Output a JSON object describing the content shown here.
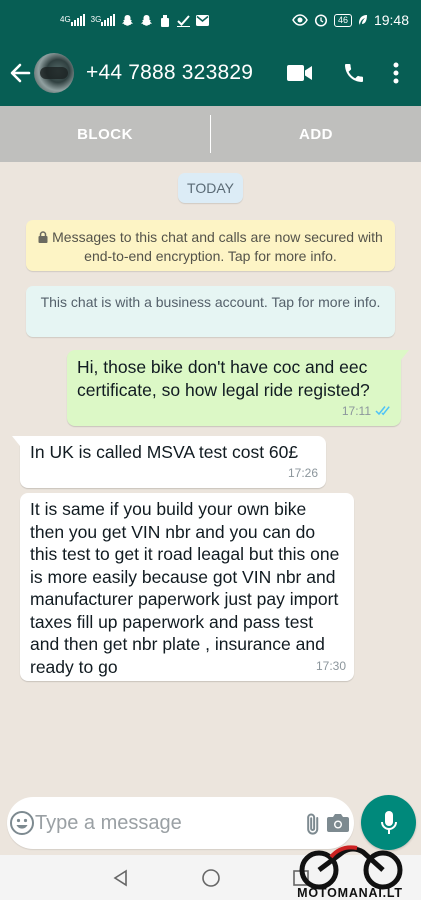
{
  "status_bar": {
    "left_icons": [
      "4G-signal-icon",
      "3G-signal-icon",
      "snapchat-icon",
      "snapchat-icon",
      "clean-icon",
      "check-icon",
      "gmail-icon"
    ],
    "network_label_1": "4G",
    "network_label_2": "3G",
    "battery": "46",
    "time": "19:48"
  },
  "header": {
    "contact_name": "+44 7888 323829"
  },
  "action_bar": {
    "block_label": "BLOCK",
    "add_label": "ADD"
  },
  "chat": {
    "date_pill": "TODAY",
    "encryption_notice": "Messages to this chat and calls are now secured with end-to-end encryption. Tap for more info.",
    "business_notice": "This chat is with a business account. Tap for more info.",
    "messages": [
      {
        "direction": "outgoing",
        "text": "Hi, those bike don't have coc and eec certificate, so how legal ride registed?",
        "time": "17:11",
        "status": "read"
      },
      {
        "direction": "incoming",
        "text": "In UK is called MSVA test cost 60£",
        "time": "17:26"
      },
      {
        "direction": "incoming",
        "text": "It is same if you build your own bike then you get VIN nbr and you can do this test to get it road leagal but this one is more easily because got VIN nbr and manufacturer paperwork just pay import taxes fill up paperwork and pass test and then get nbr plate , insurance and ready to go",
        "time": "17:30"
      }
    ]
  },
  "composer": {
    "placeholder": "Type a message",
    "value": ""
  },
  "watermark": {
    "text": "MOTOMANAI.LT"
  },
  "colors": {
    "header": "#075e54",
    "action_bar": "#bfbfbd",
    "chat_bg": "#ece5dd",
    "outgoing_bubble": "#dcf8c6",
    "incoming_bubble": "#ffffff",
    "mic_button": "#00897b",
    "read_ticks": "#4fc3f7"
  }
}
